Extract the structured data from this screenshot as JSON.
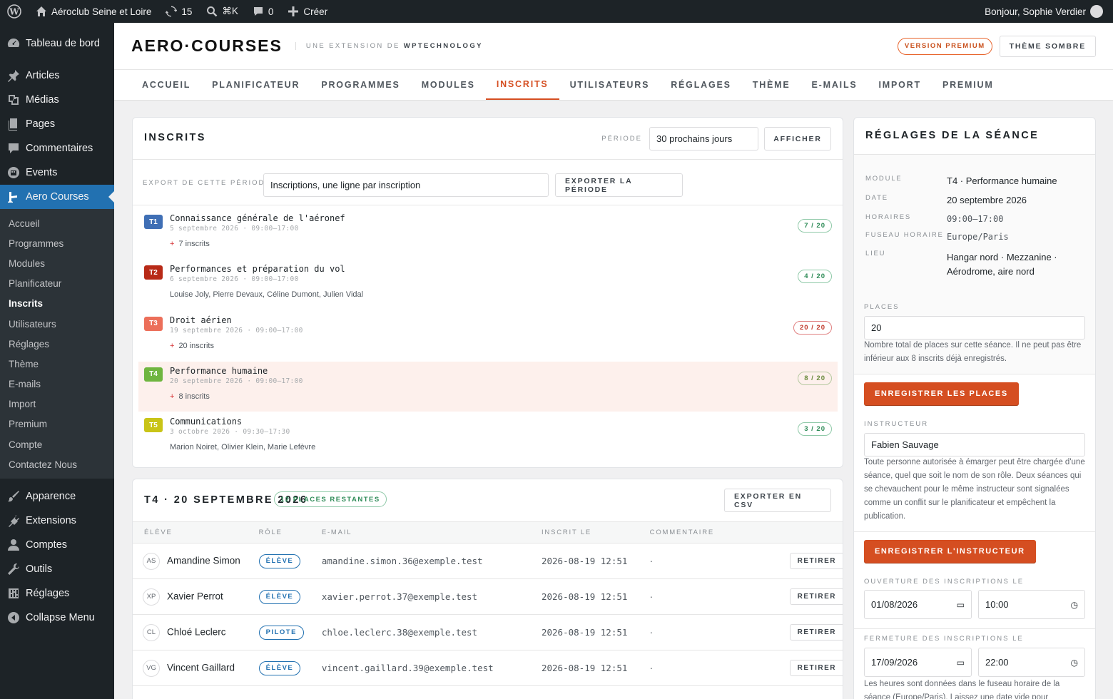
{
  "adminbar": {
    "site_name": "Aéroclub Seine et Loire",
    "updates_count": "15",
    "search_shortcut": "⌘K",
    "comments_count": "0",
    "new_label": "Créer",
    "greeting": "Bonjour, Sophie Verdier"
  },
  "sidebar": {
    "dashboard": "Tableau de bord",
    "articles": "Articles",
    "medias": "Médias",
    "pages": "Pages",
    "comments": "Commentaires",
    "events": "Events",
    "aero": "Aero Courses",
    "submenu": [
      "Accueil",
      "Programmes",
      "Modules",
      "Planificateur",
      "Inscrits",
      "Utilisateurs",
      "Réglages",
      "Thème",
      "E-mails",
      "Import",
      "Premium",
      "Compte",
      "Contactez Nous"
    ],
    "appearance": "Apparence",
    "extensions": "Extensions",
    "accounts": "Comptes",
    "tools": "Outils",
    "settings": "Réglages",
    "collapse": "Collapse Menu"
  },
  "header": {
    "brand": "AERO·COURSES",
    "subtitle_prefix": "UNE EXTENSION DE ",
    "subtitle_brand": "WPTECHNOLOGY",
    "premium_label": "VERSION PREMIUM",
    "dark_theme_label": "THÈME SOMBRE"
  },
  "tabs": [
    "ACCUEIL",
    "PLANIFICATEUR",
    "PROGRAMMES",
    "MODULES",
    "INSCRITS",
    "UTILISATEURS",
    "RÉGLAGES",
    "THÈME",
    "E-MAILS",
    "IMPORT",
    "PREMIUM"
  ],
  "inscrits": {
    "title": "INSCRITS",
    "period_label": "PÉRIODE",
    "period_value": "30 prochains jours",
    "show_button": "AFFICHER",
    "export_label": "EXPORT DE CETTE PÉRIODE",
    "export_value": "Inscriptions, une ligne par inscription",
    "export_button": "EXPORTER LA PÉRIODE",
    "sessions": [
      {
        "code": "T1",
        "title": "Connaissance générale de l'aéronef",
        "date": "5 septembre 2026 · 09:00–17:00",
        "extra": "7 inscrits",
        "plus": true,
        "capacity": "7 / 20",
        "color": "#3f6fb5"
      },
      {
        "code": "T2",
        "title": "Performances et préparation du vol",
        "date": "6 septembre 2026 · 09:00–17:00",
        "extra": "Louise Joly,  Pierre Devaux,  Céline Dumont,  Julien Vidal",
        "plus": false,
        "capacity": "4 / 20",
        "color": "#b82a17"
      },
      {
        "code": "T3",
        "title": "Droit aérien",
        "date": "19 septembre 2026 · 09:00–17:00",
        "extra": "20 inscrits",
        "plus": true,
        "capacity": "20 / 20",
        "color": "#ec6f5a"
      },
      {
        "code": "T4",
        "title": "Performance humaine",
        "date": "20 septembre 2026 · 09:00–17:00",
        "extra": "8 inscrits",
        "plus": true,
        "capacity": "8 / 20",
        "color": "#6fb53f"
      },
      {
        "code": "T5",
        "title": "Communications",
        "date": "3 octobre 2026 · 09:30–17:30",
        "extra": "Marion Noiret,  Olivier Klein,  Marie Lefèvre",
        "plus": false,
        "capacity": "3 / 20",
        "color": "#c9c417"
      }
    ]
  },
  "detail": {
    "title": "T4 · 20 SEPTEMBRE 2026",
    "remaining": "12 PLACES RESTANTES",
    "export_csv": "EXPORTER EN CSV",
    "columns": [
      "ÉLÈVE",
      "RÔLE",
      "E-MAIL",
      "INSCRIT LE",
      "COMMENTAIRE"
    ],
    "rows": [
      {
        "initials": "AS",
        "name": "Amandine Simon",
        "role": "ÉLÈVE",
        "email": "amandine.simon.36@exemple.test",
        "date": "2026-08-19 12:51",
        "comment": "·",
        "action": "RETIRER"
      },
      {
        "initials": "XP",
        "name": "Xavier Perrot",
        "role": "ÉLÈVE",
        "email": "xavier.perrot.37@exemple.test",
        "date": "2026-08-19 12:51",
        "comment": "·",
        "action": "RETIRER"
      },
      {
        "initials": "CL",
        "name": "Chloé Leclerc",
        "role": "PILOTE",
        "email": "chloe.leclerc.38@exemple.test",
        "date": "2026-08-19 12:51",
        "comment": "·",
        "action": "RETIRER"
      },
      {
        "initials": "VG",
        "name": "Vincent Gaillard",
        "role": "ÉLÈVE",
        "email": "vincent.gaillard.39@exemple.test",
        "date": "2026-08-19 12:51",
        "comment": "·",
        "action": "RETIRER"
      }
    ]
  },
  "settings": {
    "title": "RÉGLAGES DE LA SÉANCE",
    "module_label": "MODULE",
    "module_value": "T4 · Performance humaine",
    "date_label": "DATE",
    "date_value": "20 septembre 2026",
    "hours_label": "HORAIRES",
    "hours_value": "09:00–17:00",
    "tz_label": "FUSEAU HORAIRE",
    "tz_value": "Europe/Paris",
    "place_label": "LIEU",
    "place_line1": "Hangar nord · Mezzanine ·",
    "place_line2": "Aérodrome, aire nord",
    "places_label": "PLACES",
    "places_value": "20",
    "places_help": "Nombre total de places sur cette séance. Il ne peut pas être inférieur aux 8 inscrits déjà enregistrés.",
    "save_places": "ENREGISTRER LES PLACES",
    "instructor_label": "INSTRUCTEUR",
    "instructor_value": "Fabien Sauvage",
    "instructor_help": "Toute personne autorisée à émarger peut être chargée d'une séance, quel que soit le nom de son rôle. Deux séances qui se chevauchent pour le même instructeur sont signalées comme un conflit sur le planificateur et empêchent la publication.",
    "save_instructor": "ENREGISTRER L'INSTRUCTEUR",
    "open_label": "OUVERTURE DES INSCRIPTIONS LE",
    "open_date": "01/08/2026",
    "open_time": "10:00",
    "close_label": "FERMETURE DES INSCRIPTIONS LE",
    "close_date": "17/09/2026",
    "close_time": "22:00",
    "close_help": "Les heures sont données dans le fuseau horaire de la séance (Europe/Paris). Laissez une date vide pour"
  },
  "colors": {
    "accent": "#d54e21",
    "wp_blue": "#2271b1",
    "admin_dark": "#1d2327"
  }
}
